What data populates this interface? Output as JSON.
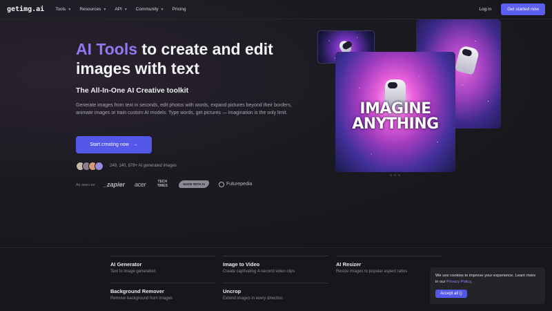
{
  "nav": {
    "logo": "getimg.ai",
    "items": [
      {
        "label": "Tools",
        "has_dropdown": true
      },
      {
        "label": "Resources",
        "has_dropdown": true
      },
      {
        "label": "API",
        "has_dropdown": true
      },
      {
        "label": "Community",
        "has_dropdown": true
      },
      {
        "label": "Pricing",
        "has_dropdown": false
      }
    ],
    "login": "Log in",
    "cta": "Get started now",
    "chevron_icon": "chevron-down-icon"
  },
  "hero": {
    "title_accent": "AI Tools",
    "title_rest": " to create and edit images with text",
    "subtitle": "The All-In-One AI Creative toolkit",
    "description": "Generate images from text in seconds, edit photos with words, expand pictures beyond their borders, animate images or train custom AI models. Type words, get pictures — imagination is the only limit.",
    "cta": "Start creating now",
    "cta_icon": "arrow-right-icon",
    "generated_count": "249, 140, 879+ AI generated images",
    "as_seen_on": "As seen on",
    "brands": {
      "zapier": "_zapier",
      "acer": "acer",
      "tech_times": "TECH TIMES",
      "made": "MADE WITH AI",
      "futurepedia": "Futurepedia"
    },
    "showcase_text": "IMAGINE ANYTHING"
  },
  "features": [
    {
      "title": "AI Generator",
      "desc": "Text to image generation"
    },
    {
      "title": "Image to Video",
      "desc": "Create captivating 4-second video clips"
    },
    {
      "title": "AI Resizer",
      "desc": "Resize images to popular aspect ratios"
    },
    {
      "title": "Background Remover",
      "desc": "Remove background from images"
    },
    {
      "title": "Uncrop",
      "desc": "Extend images in every direction"
    }
  ],
  "cookie": {
    "text": "We use cookies to improve your experience. Learn more in our ",
    "link": "Privacy Policy",
    "end": ".",
    "button": "Accept all ()"
  },
  "colors": {
    "accent": "#5457e8",
    "title_accent": "#8f79f2",
    "background": "#17171b"
  }
}
